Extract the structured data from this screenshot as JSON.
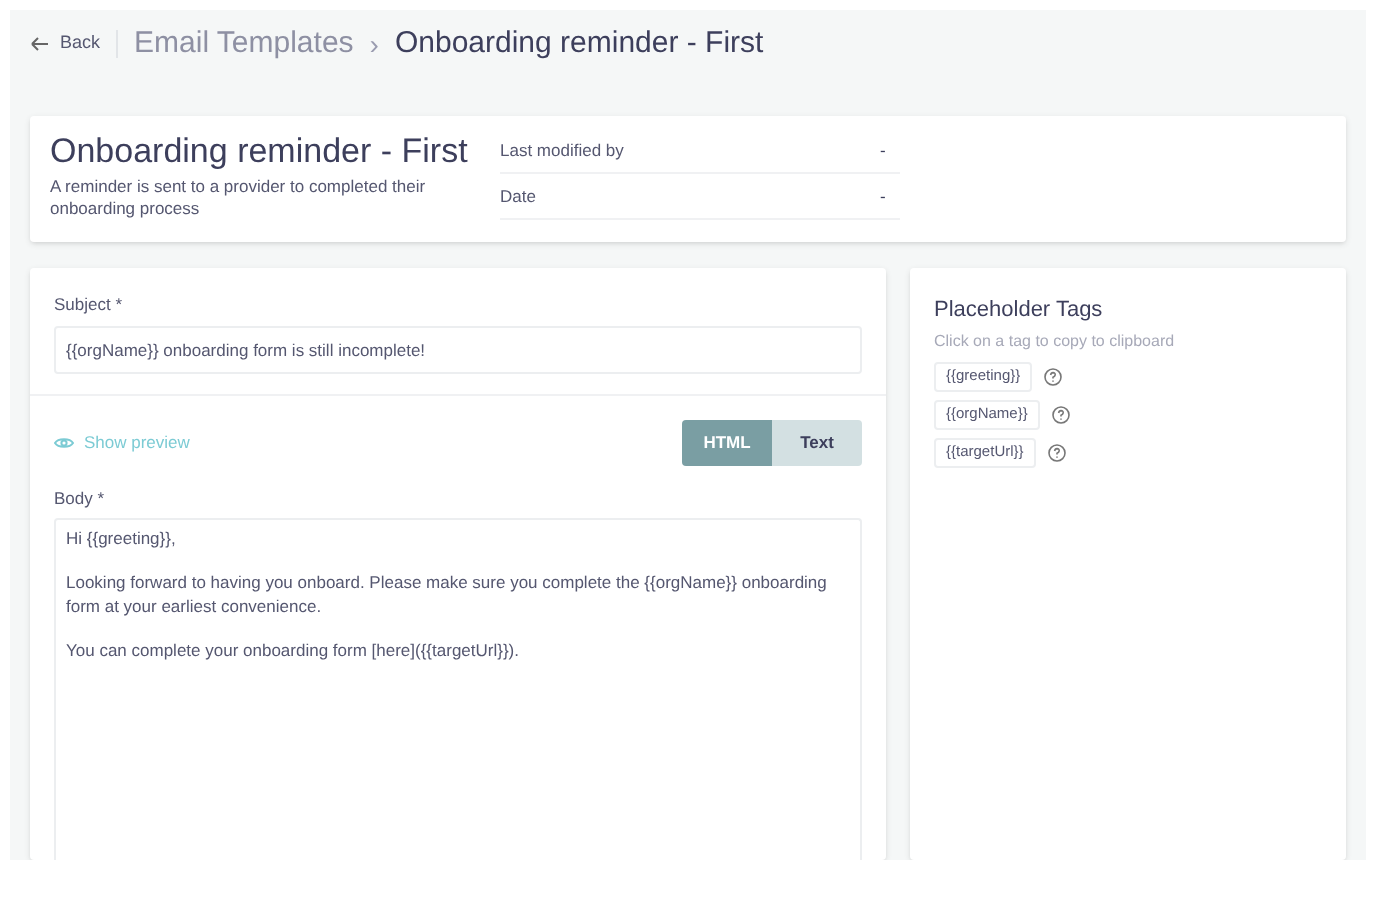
{
  "header": {
    "back": "Back",
    "breadcrumb": "Email Templates",
    "separator": "›",
    "title": "Onboarding reminder - First"
  },
  "summary": {
    "title": "Onboarding reminder - First",
    "description": "A reminder is sent to a provider to completed their onboarding process",
    "meta": [
      {
        "label": "Last modified by",
        "value": "-"
      },
      {
        "label": "Date",
        "value": "-"
      }
    ]
  },
  "editor": {
    "subject_label": "Subject *",
    "subject_value": "{{orgName}} onboarding form is still incomplete!",
    "preview_link": "Show preview",
    "formats": [
      {
        "label": "HTML",
        "selected": true
      },
      {
        "label": "Text",
        "selected": false
      }
    ],
    "body_label": "Body *",
    "body_paragraphs": [
      "Hi {{greeting}},",
      "Looking forward to having you onboard. Please make sure you complete the {{orgName}} onboarding form at your earliest convenience.",
      "You can complete your onboarding form [here]({{targetUrl}})."
    ]
  },
  "placeholder_tags": {
    "title": "Placeholder Tags",
    "hint": "Click on a tag to copy to clipboard",
    "tags": [
      "{{greeting}}",
      "{{orgName}}",
      "{{targetUrl}}"
    ]
  }
}
